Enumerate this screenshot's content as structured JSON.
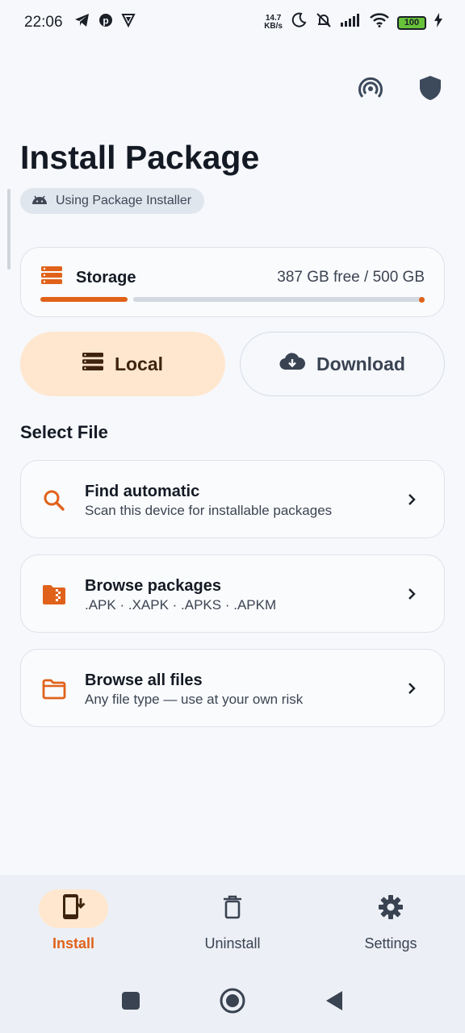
{
  "status_bar": {
    "time": "22:06",
    "speed_value": "14.7",
    "speed_unit": "KB/s",
    "battery": "100",
    "icons": [
      "telegram-icon",
      "pinterest-icon",
      "vpn-icon",
      "moon-icon",
      "silent-icon",
      "signal-icon",
      "wifi-icon",
      "battery-icon",
      "charging-icon"
    ]
  },
  "header": {
    "title": "Install Package",
    "installer_chip": "Using Package Installer",
    "actions": [
      "broadcast-icon",
      "shield-icon"
    ]
  },
  "storage": {
    "label": "Storage",
    "value": "387 GB free / 500 GB",
    "used_fraction": 0.226
  },
  "source_tabs": {
    "local": "Local",
    "download": "Download",
    "selected": "Local"
  },
  "select_file": {
    "title": "Select File",
    "items": [
      {
        "title": "Find automatic",
        "subtitle": "Scan this device for installable packages",
        "icon": "search-icon"
      },
      {
        "title": "Browse packages",
        "subtitle": ".APK · .XAPK · .APKS · .APKM",
        "icon": "archive-folder-icon"
      },
      {
        "title": "Browse all files",
        "subtitle": "Any file type — use at your own risk",
        "icon": "folder-icon"
      }
    ]
  },
  "bottom_nav": {
    "items": [
      {
        "label": "Install",
        "icon": "install-phone-icon"
      },
      {
        "label": "Uninstall",
        "icon": "trash-icon"
      },
      {
        "label": "Settings",
        "icon": "gear-icon"
      }
    ],
    "selected": "Install"
  },
  "colors": {
    "accent": "#e0621a",
    "accent_soft": "#ffe7cf",
    "background": "#f6f8fc"
  }
}
